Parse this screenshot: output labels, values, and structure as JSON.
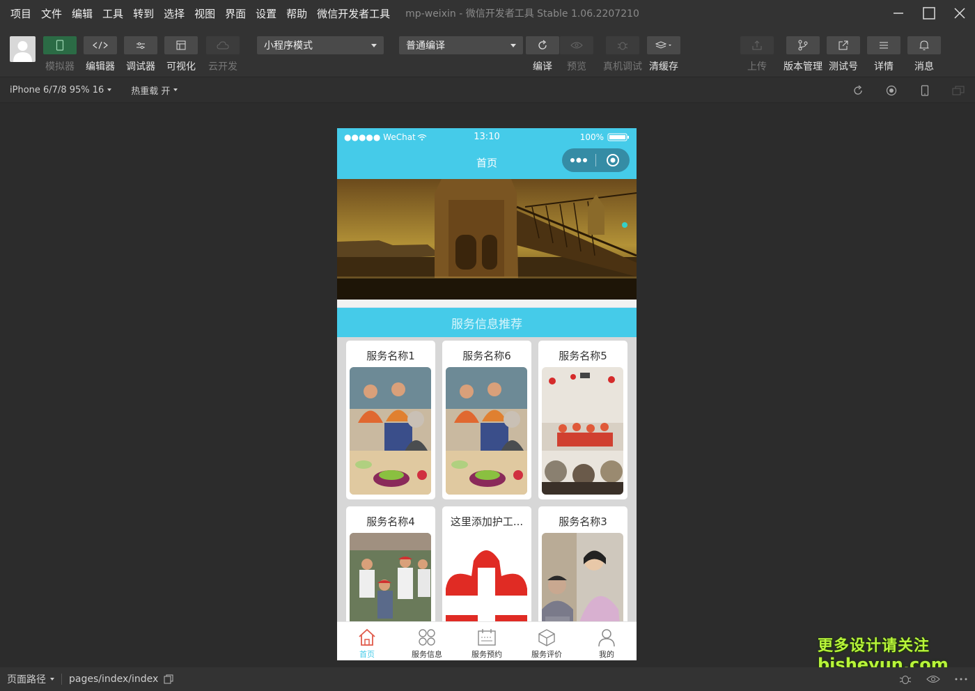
{
  "menu": [
    "项目",
    "文件",
    "编辑",
    "工具",
    "转到",
    "选择",
    "视图",
    "界面",
    "设置",
    "帮助",
    "微信开发者工具"
  ],
  "window_title": "mp-weixin - 微信开发者工具 Stable 1.06.2207210",
  "toolbar": {
    "simulator": "模拟器",
    "editor": "编辑器",
    "debugger": "调试器",
    "visual": "可视化",
    "cloud": "云开发",
    "mode_select": "小程序模式",
    "compile_select": "普通编译",
    "compile": "编译",
    "preview": "预览",
    "remote_debug": "真机调试",
    "clear_cache": "清缓存",
    "upload": "上传",
    "version": "版本管理",
    "test_account": "测试号",
    "details": "详情",
    "messages": "消息"
  },
  "subbar": {
    "device": "iPhone 6/7/8 95% 16",
    "hot_reload": "热重载 开"
  },
  "phone": {
    "carrier": "●●●●● WeChat",
    "time": "13:10",
    "battery": "100%",
    "nav_title": "首页",
    "section_title": "服务信息推荐",
    "cards": [
      {
        "title": "服务名称1"
      },
      {
        "title": "服务名称6"
      },
      {
        "title": "服务名称5"
      },
      {
        "title": "服务名称4"
      },
      {
        "title": "这里添加护工..."
      },
      {
        "title": "服务名称3"
      }
    ],
    "tabs": [
      {
        "label": "首页",
        "icon": "home-icon"
      },
      {
        "label": "服务信息",
        "icon": "grid-icon"
      },
      {
        "label": "服务预约",
        "icon": "calendar-icon"
      },
      {
        "label": "服务评价",
        "icon": "box-icon"
      },
      {
        "label": "我的",
        "icon": "user-icon"
      }
    ]
  },
  "bottombar": {
    "path_label": "页面路径",
    "path_value": "pages/index/index"
  },
  "watermark": {
    "line1": "更多设计请关注",
    "line2": "bisheyun.com"
  },
  "colors": {
    "accent": "#45cbe9",
    "toolbar_bg": "#333333",
    "canvas_bg": "#2c2c2c",
    "active_green": "#2b6b45"
  }
}
